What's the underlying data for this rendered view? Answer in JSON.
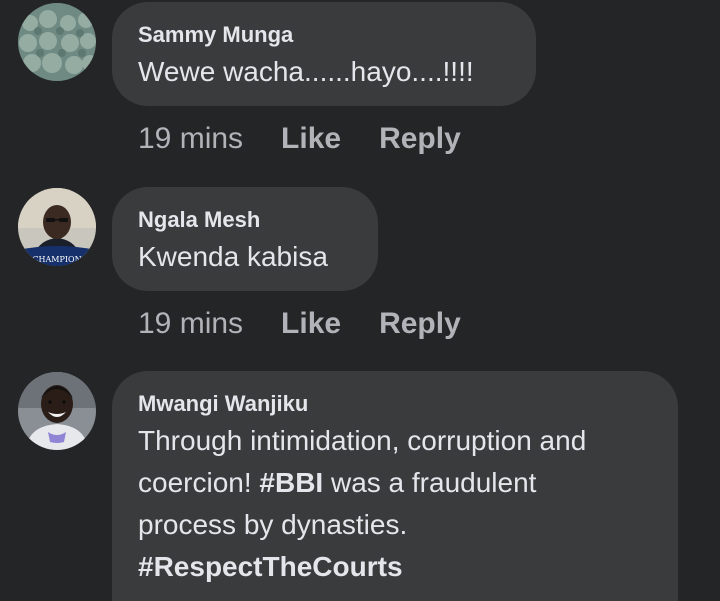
{
  "comments": [
    {
      "author": "Sammy Munga",
      "text": "Wewe wacha......hayo....!!!!",
      "time": "19 mins",
      "like_label": "Like",
      "reply_label": "Reply",
      "avatar_icon": "avatar-cabbage-field"
    },
    {
      "author": "Ngala Mesh",
      "text": "Kwenda kabisa",
      "time": "19 mins",
      "like_label": "Like",
      "reply_label": "Reply",
      "avatar_icon": "avatar-man-portrait",
      "avatar_badge": "CHAMPION"
    },
    {
      "author": "Mwangi Wanjiku",
      "text_line1": "Through intimidation, corruption and",
      "text_line2_pre": "coercion! ",
      "hashtag1": "#BBI",
      "text_line2_post": " was a fraudulent",
      "text_line3": "process by dynasties.",
      "hashtag2": "#RespectTheCourts",
      "avatar_icon": "avatar-man-smiling"
    }
  ],
  "colors": {
    "background": "#242526",
    "bubble": "#3a3b3c",
    "primary_text": "#e4e6eb",
    "secondary_text": "#b0b3b8"
  }
}
